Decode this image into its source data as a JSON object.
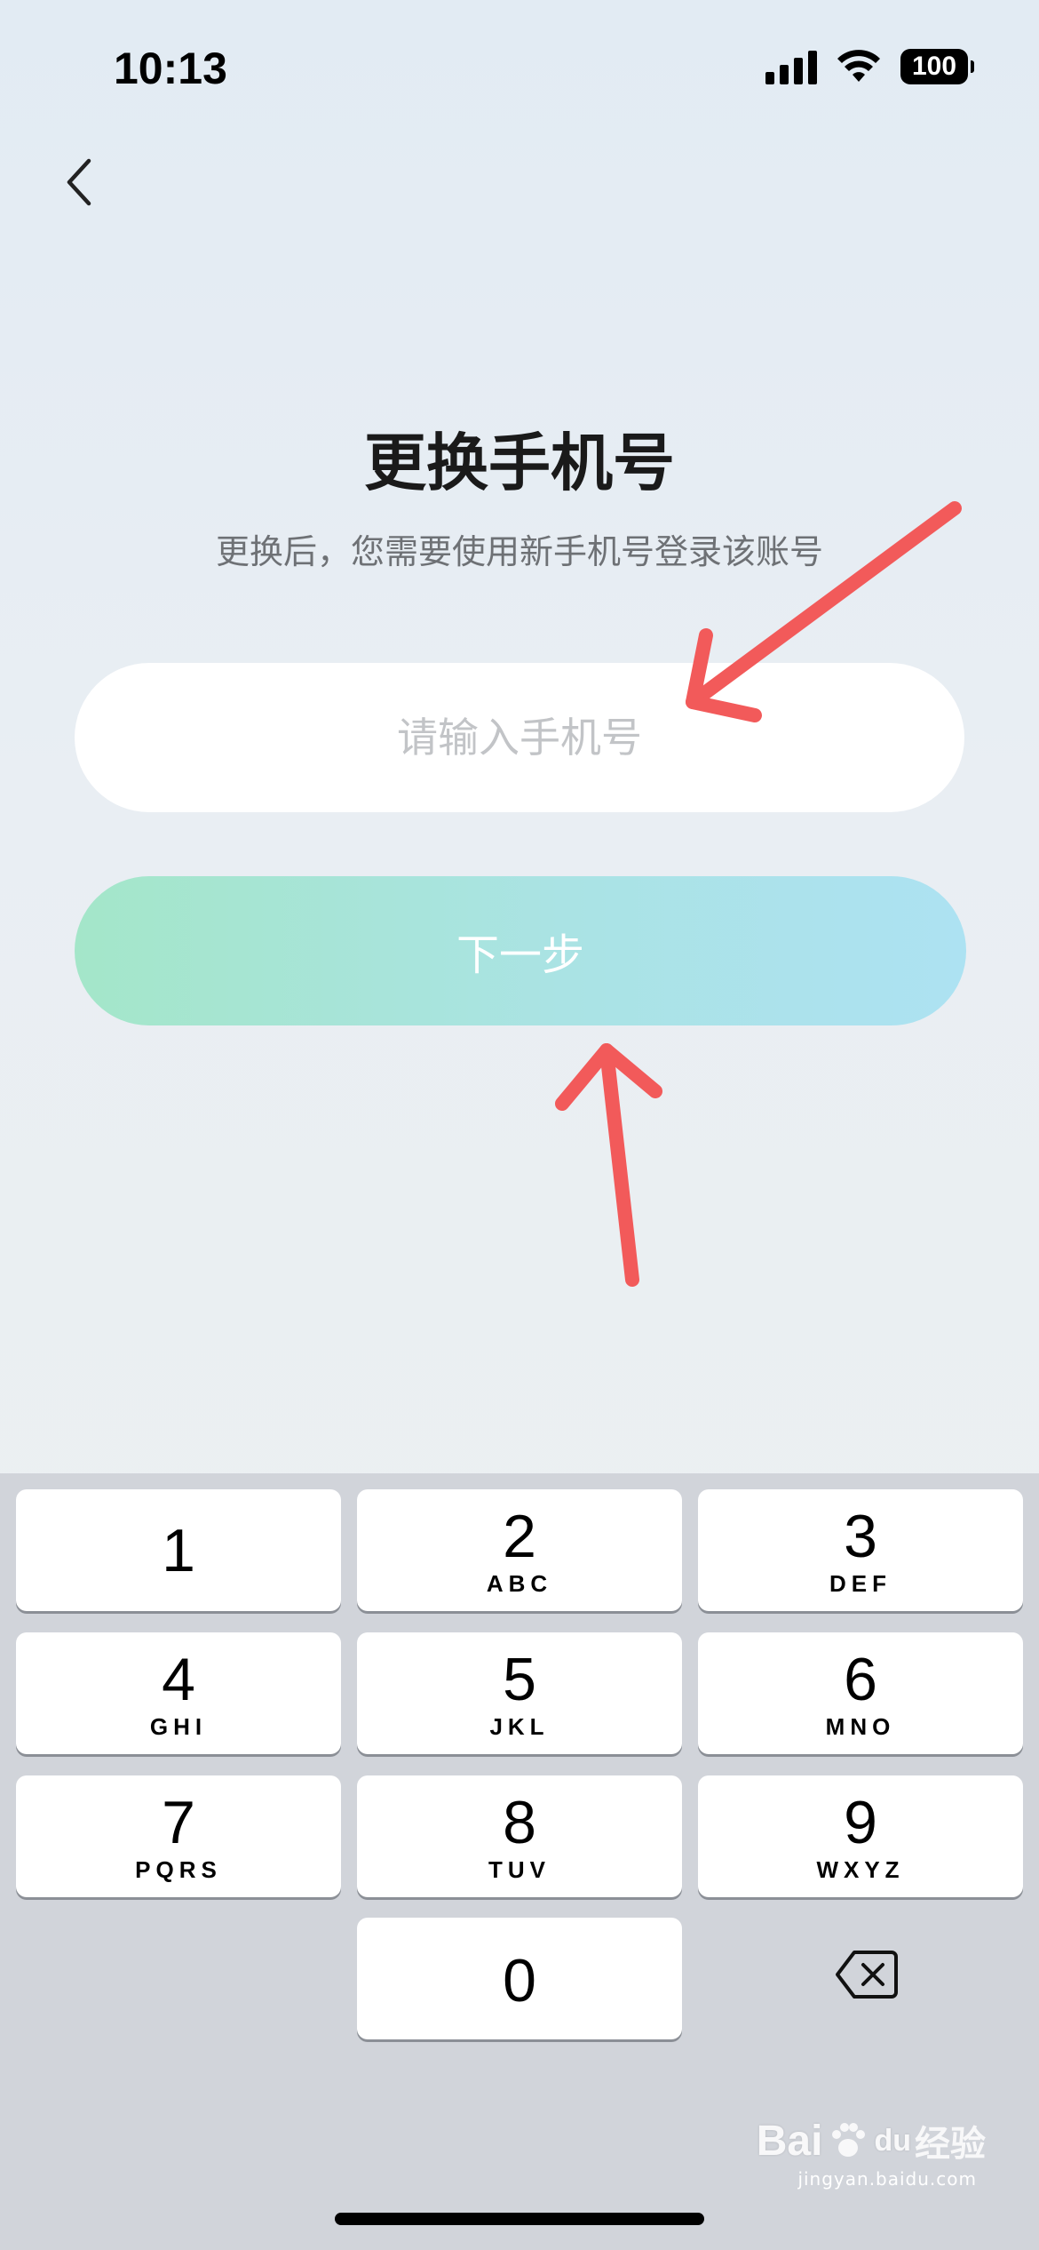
{
  "status_bar": {
    "time": "10:13",
    "battery": "100",
    "icons": [
      "signal-icon",
      "wifi-icon",
      "battery-icon"
    ]
  },
  "nav": {
    "back_icon": "chevron-left-icon"
  },
  "page": {
    "title": "更换手机号",
    "subtitle": "更换后，您需要使用新手机号登录该账号"
  },
  "form": {
    "phone_placeholder": "请输入手机号",
    "phone_value": "",
    "next_label": "下一步",
    "next_gradient": [
      "#a4e6c9",
      "#ade2f2"
    ]
  },
  "annotations": {
    "arrow_color": "#f25a5a"
  },
  "keyboard": {
    "keys": [
      {
        "digit": "1",
        "letters": ""
      },
      {
        "digit": "2",
        "letters": "ABC"
      },
      {
        "digit": "3",
        "letters": "DEF"
      },
      {
        "digit": "4",
        "letters": "GHI"
      },
      {
        "digit": "5",
        "letters": "JKL"
      },
      {
        "digit": "6",
        "letters": "MNO"
      },
      {
        "digit": "7",
        "letters": "PQRS"
      },
      {
        "digit": "8",
        "letters": "TUV"
      },
      {
        "digit": "9",
        "letters": "WXYZ"
      },
      {
        "digit": "0",
        "letters": ""
      }
    ],
    "delete_icon": "backspace-icon"
  },
  "watermark": {
    "logo": "Bai",
    "logo2": "du",
    "cn": "经验",
    "site": "jingyan.baidu.com"
  }
}
